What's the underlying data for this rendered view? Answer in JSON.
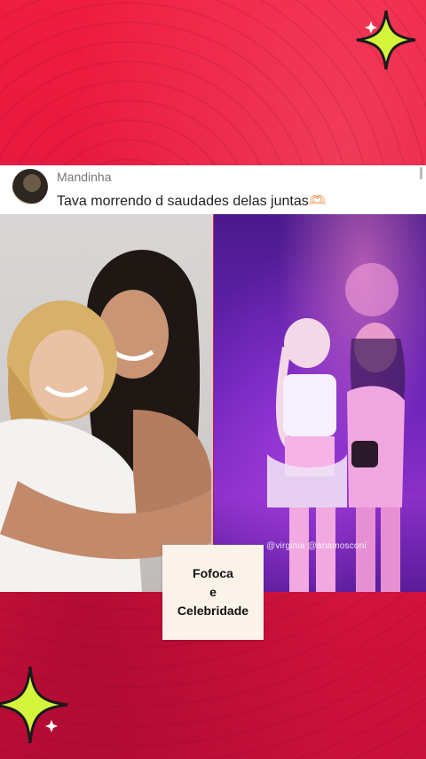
{
  "comment": {
    "username": "Mandinha",
    "text": "Tava morrendo d saudades delas juntas🫶🏻"
  },
  "photo_tag": "@virginia @anamosconi",
  "label": {
    "line1": "Fofoca",
    "line2": "e",
    "line3": "Celebridade"
  },
  "colors": {
    "background": "#e8163a",
    "sparkle": "#d4f53c"
  }
}
